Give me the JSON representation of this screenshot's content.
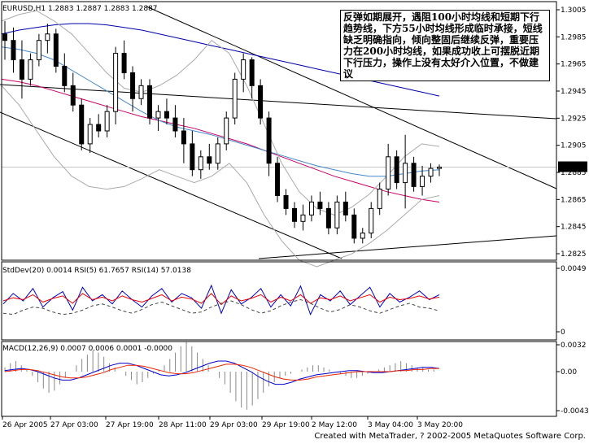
{
  "chart_data": [
    {
      "type": "line",
      "panel": "price",
      "title": "EURUSD,H1  1.2883 1.2887 1.2883 1.2887",
      "current_price": "1.2887",
      "yticks": [
        "1.3005",
        "1.2985",
        "1.2965",
        "1.2945",
        "1.2925",
        "1.2905",
        "1.2885",
        "1.2865",
        "1.2845",
        "1.2825"
      ],
      "ylim": [
        1.2815,
        1.3015
      ],
      "candles": [
        [
          1.299,
          1.3,
          1.297,
          1.2985
        ],
        [
          1.2985,
          1.2995,
          1.296,
          1.297
        ],
        [
          1.297,
          1.2985,
          1.294,
          1.2955
        ],
        [
          1.2955,
          1.2975,
          1.295,
          1.297
        ],
        [
          1.297,
          1.299,
          1.2965,
          1.2985
        ],
        [
          1.2985,
          1.2998,
          1.2975,
          1.299
        ],
        [
          1.299,
          1.2994,
          1.296,
          1.2965
        ],
        [
          1.2965,
          1.2975,
          1.2945,
          1.295
        ],
        [
          1.295,
          1.296,
          1.293,
          1.2935
        ],
        [
          1.2935,
          1.294,
          1.29,
          1.2905
        ],
        [
          1.2905,
          1.2925,
          1.2898,
          1.292
        ],
        [
          1.292,
          1.2928,
          1.291,
          1.2915
        ],
        [
          1.2915,
          1.2935,
          1.291,
          1.293
        ],
        [
          1.293,
          1.298,
          1.292,
          1.2975
        ],
        [
          1.2975,
          1.2985,
          1.2955,
          1.296
        ],
        [
          1.296,
          1.2965,
          1.293,
          1.294
        ],
        [
          1.294,
          1.2955,
          1.2935,
          1.295
        ],
        [
          1.295,
          1.2955,
          1.292,
          1.2925
        ],
        [
          1.2925,
          1.2935,
          1.2915,
          1.293
        ],
        [
          1.293,
          1.294,
          1.292,
          1.2925
        ],
        [
          1.2925,
          1.2935,
          1.291,
          1.2915
        ],
        [
          1.2915,
          1.2925,
          1.289,
          1.2905
        ],
        [
          1.2905,
          1.2915,
          1.288,
          1.2885
        ],
        [
          1.2885,
          1.29,
          1.2878,
          1.2895
        ],
        [
          1.2895,
          1.2905,
          1.2885,
          1.289
        ],
        [
          1.289,
          1.291,
          1.2885,
          1.2905
        ],
        [
          1.2905,
          1.293,
          1.29,
          1.2925
        ],
        [
          1.2925,
          1.296,
          1.292,
          1.2955
        ],
        [
          1.2955,
          1.2975,
          1.2945,
          1.297
        ],
        [
          1.297,
          1.2972,
          1.294,
          1.295
        ],
        [
          1.295,
          1.2955,
          1.292,
          1.2925
        ],
        [
          1.2925,
          1.293,
          1.288,
          1.289
        ],
        [
          1.289,
          1.2895,
          1.286,
          1.2865
        ],
        [
          1.2865,
          1.287,
          1.285,
          1.2855
        ],
        [
          1.2855,
          1.286,
          1.284,
          1.2845
        ],
        [
          1.2845,
          1.2858,
          1.2838,
          1.285
        ],
        [
          1.285,
          1.2865,
          1.2845,
          1.286
        ],
        [
          1.286,
          1.2868,
          1.285,
          1.2855
        ],
        [
          1.2855,
          1.286,
          1.2835,
          1.284
        ],
        [
          1.284,
          1.2865,
          1.2835,
          1.286
        ],
        [
          1.286,
          1.2868,
          1.2845,
          1.285
        ],
        [
          1.285,
          1.2855,
          1.2828,
          1.2832
        ],
        [
          1.2832,
          1.284,
          1.2828,
          1.2836
        ],
        [
          1.2836,
          1.286,
          1.2832,
          1.2855
        ],
        [
          1.2855,
          1.2875,
          1.285,
          1.287
        ],
        [
          1.287,
          1.2905,
          1.2865,
          1.2895
        ],
        [
          1.2895,
          1.29,
          1.287,
          1.2875
        ],
        [
          1.2875,
          1.2912,
          1.2855,
          1.289
        ],
        [
          1.289,
          1.2895,
          1.2868,
          1.2872
        ],
        [
          1.2872,
          1.2888,
          1.2865,
          1.288
        ],
        [
          1.288,
          1.289,
          1.2875,
          1.2886
        ],
        [
          1.2886,
          1.2889,
          1.288,
          1.2887
        ]
      ],
      "series": [
        {
          "color": "#0000aa",
          "values": [
            1.299,
            1.2993,
            1.2995,
            1.2997,
            1.2998,
            1.2998,
            1.2997,
            1.2995,
            1.2993,
            1.299,
            1.2987,
            1.2984,
            1.2981,
            1.2978,
            1.2975,
            1.2972,
            1.2969,
            1.2966,
            1.2963,
            1.296,
            1.2957,
            1.2954,
            1.2951,
            1.2948,
            1.2945,
            1.2942
          ]
        },
        {
          "color": "#cc0066",
          "values": [
            1.2955,
            1.2953,
            1.295,
            1.2946,
            1.2942,
            1.2938,
            1.2934,
            1.293,
            1.2926,
            1.2923,
            1.292,
            1.2917,
            1.2913,
            1.2909,
            1.2905,
            1.29,
            1.2895,
            1.289,
            1.2885,
            1.288,
            1.2876,
            1.2872,
            1.2868,
            1.2865,
            1.2862,
            1.286
          ]
        },
        {
          "color": "#4488cc",
          "values": [
            1.298,
            1.2978,
            1.2975,
            1.297,
            1.2962,
            1.2954,
            1.2946,
            1.2938,
            1.293,
            1.2923,
            1.2918,
            1.2915,
            1.2912,
            1.2908,
            1.2904,
            1.29,
            1.2896,
            1.2892,
            1.2888,
            1.2885,
            1.2882,
            1.288,
            1.288,
            1.2882,
            1.2884,
            1.2885
          ]
        },
        {
          "color": "#aaaaaa",
          "values": [
            1.3,
            1.3005,
            1.3008,
            1.3,
            1.299,
            1.2975,
            1.296,
            1.2948,
            1.2945,
            1.295,
            1.2958,
            1.297,
            1.2985,
            1.2975,
            1.295,
            1.292,
            1.289,
            1.2868,
            1.2855,
            1.285,
            1.2856,
            1.2866,
            1.288,
            1.2895,
            1.2905,
            1.2903
          ]
        },
        {
          "color": "#aaaaaa",
          "values": [
            1.295,
            1.2935,
            1.2915,
            1.2895,
            1.288,
            1.2872,
            1.287,
            1.2872,
            1.2878,
            1.2885,
            1.288,
            1.2875,
            1.288,
            1.289,
            1.2875,
            1.285,
            1.283,
            1.2815,
            1.281,
            1.2815,
            1.282,
            1.2828,
            1.2838,
            1.285,
            1.2862,
            1.2865
          ]
        }
      ]
    },
    {
      "type": "line",
      "panel": "stddev_rsi",
      "title": "StdDev(20) 0.0014  RSI(5) 61.7657  RSI(14) 57.0138",
      "yticks": [
        "0.0049",
        "0"
      ],
      "series": [
        {
          "color": "#0000cc",
          "values": [
            45,
            62,
            50,
            70,
            40,
            55,
            65,
            35,
            72,
            50,
            60,
            45,
            66,
            52,
            40,
            58,
            70,
            48,
            62,
            55,
            38,
            75,
            30,
            68,
            45,
            55,
            70,
            40,
            60,
            42,
            74,
            28,
            60,
            50,
            66,
            44,
            58,
            72,
            40,
            62,
            48,
            56,
            66,
            52,
            60
          ]
        },
        {
          "color": "#ee0000",
          "values": [
            50,
            55,
            52,
            60,
            48,
            54,
            58,
            46,
            62,
            52,
            56,
            50,
            58,
            52,
            48,
            54,
            60,
            50,
            56,
            53,
            46,
            62,
            44,
            58,
            50,
            54,
            60,
            48,
            56,
            50,
            60,
            46,
            55,
            52,
            58,
            50,
            55,
            60,
            48,
            56,
            52,
            54,
            58,
            53,
            56
          ]
        },
        {
          "color": "#444444",
          "values": [
            30,
            28,
            35,
            40,
            38,
            32,
            28,
            30,
            35,
            42,
            45,
            40,
            34,
            30,
            36,
            44,
            48,
            42,
            36,
            30,
            32,
            40,
            46,
            50,
            44,
            36,
            30,
            34,
            42,
            48,
            52,
            46,
            38,
            32,
            36,
            44,
            40,
            34,
            30,
            36,
            42,
            46,
            40,
            38,
            34
          ]
        }
      ]
    },
    {
      "type": "bar",
      "panel": "macd",
      "title": "MACD(12,26,9) 0.0007 0.0006 0.0001 -0.0000",
      "yticks": [
        "0.0032",
        "0.00",
        "-0.0043"
      ],
      "histogram": [
        2,
        4,
        5,
        3,
        1,
        -2,
        -5,
        -8,
        -10,
        -9,
        -6,
        -3,
        0,
        3,
        6,
        8,
        10,
        9,
        7,
        4,
        2,
        0,
        -2,
        -4,
        -6,
        -5,
        -3,
        -1,
        1,
        3,
        6,
        9,
        12,
        14,
        12,
        9,
        6,
        3,
        0,
        -3,
        -6,
        -10,
        -14,
        -17,
        -18,
        -16,
        -13,
        -10,
        -7,
        -5,
        -3,
        -2,
        -1,
        0,
        1,
        2,
        3,
        3,
        2,
        1,
        0,
        -1,
        -2,
        -3,
        -3,
        -2,
        -1,
        0,
        1,
        2,
        3,
        4,
        5,
        4,
        3,
        2,
        2,
        1,
        1,
        0
      ],
      "series": [
        {
          "color": "#0000cc",
          "values": [
            1,
            2,
            3,
            2,
            0,
            -3,
            -6,
            -8,
            -8,
            -6,
            -3,
            0,
            3,
            6,
            8,
            8,
            6,
            3,
            0,
            -3,
            -4,
            -3,
            -1,
            2,
            5,
            8,
            10,
            10,
            8,
            4,
            0,
            -5,
            -9,
            -12,
            -12,
            -10,
            -7,
            -5,
            -3,
            -2,
            -1,
            0,
            1,
            1,
            0,
            -1,
            -1,
            0,
            1,
            2,
            3,
            4,
            4,
            3
          ]
        },
        {
          "color": "#ee2200",
          "values": [
            0,
            1,
            2,
            2,
            1,
            -1,
            -3,
            -5,
            -6,
            -6,
            -5,
            -3,
            -1,
            2,
            4,
            6,
            6,
            5,
            3,
            1,
            -1,
            -2,
            -2,
            -1,
            1,
            3,
            5,
            7,
            7,
            6,
            4,
            1,
            -2,
            -5,
            -7,
            -8,
            -8,
            -7,
            -5,
            -4,
            -3,
            -2,
            -1,
            0,
            0,
            0,
            0,
            0,
            1,
            1,
            2,
            2,
            3,
            3
          ]
        }
      ]
    }
  ],
  "xticks": [
    "26 Apr 2005",
    "27 Apr 03:00",
    "27 Apr 19:00",
    "28 Apr 11:00",
    "29 Apr 03:00",
    "29 Apr 19:00",
    "2 May 12:00",
    "3 May 04:00",
    "3 May 20:00"
  ],
  "annotation": "反弹如期展开，遇阻100小时均线和短期下行趋势线，下方55小时均线形成临时承接，短线缺乏明确指向，倾向整固后继续反弹，重要压力在200小时均线，如果成功收上可摆脱近期下行压力，操作上没有太好介入位置，不做建议",
  "footer": "Created with MetaTrader, ? 2002-2005 MetaQuotes Software Corp."
}
